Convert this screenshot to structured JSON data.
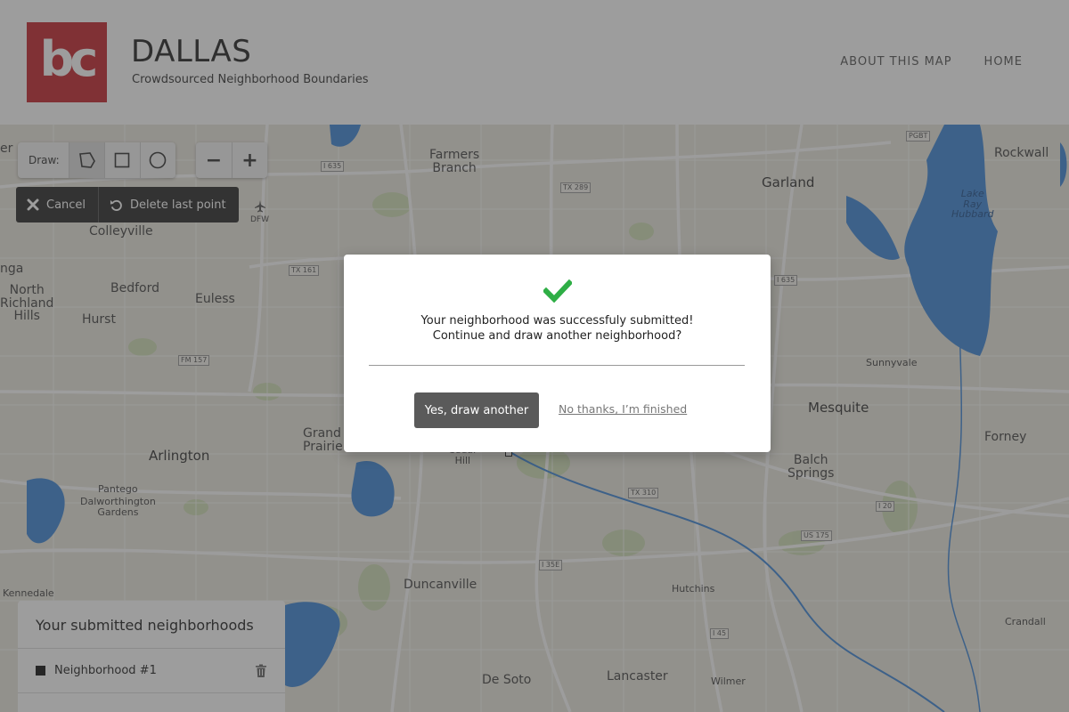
{
  "header": {
    "logo_text": "bc",
    "title": "DALLAS",
    "subtitle": "Crowdsourced Neighborhood Boundaries",
    "nav": [
      "ABOUT THIS MAP",
      "HOME"
    ]
  },
  "map_controls": {
    "draw_label": "Draw:",
    "draw_tools": [
      "polygon-icon",
      "rectangle-icon",
      "circle-icon"
    ],
    "zoom_out": "−",
    "zoom_in": "+",
    "cancel_label": "Cancel",
    "delete_last_point_label": "Delete last point"
  },
  "map_labels": {
    "farmers_branch": "Farmers\nBranch",
    "garland": "Garland",
    "rockwall": "Rockwall",
    "lake_ray_hubbard": "Lake\nRay\nHubbard",
    "colleyville": "Colleyville",
    "bedford": "Bedford",
    "euless": "Euless",
    "north_richland_hills": "North\nRichland\nHills",
    "hurst": "Hurst",
    "nga": "nga",
    "er": "er",
    "dfw": "DFW",
    "sunnyvale": "Sunnyvale",
    "mesquite": "Mesquite",
    "forney": "Forney",
    "grand_prairie": "Grand\nPrairie",
    "arlington": "Arlington",
    "cedar_hill": "Cedar\nHill",
    "balch_springs": "Balch\nSprings",
    "pantego": "Pantego",
    "dalworthington_gardens": "Dalworthington\nGardens",
    "kennedale": "Kennedale",
    "duncanville": "Duncanville",
    "hutchins": "Hutchins",
    "crandall": "Crandall",
    "de_soto": "De Soto",
    "lancaster": "Lancaster",
    "wilmer": "Wilmer"
  },
  "highway_labels": {
    "i635_w": "I 635",
    "tx289": "TX 289",
    "pgbt": "PGBT",
    "tx161": "TX 161",
    "i635_e": "I 635",
    "fm157": "FM 157",
    "tx310": "TX 310",
    "i20": "I 20",
    "us175": "US 175",
    "i35e": "I 35E",
    "i45": "I 45"
  },
  "submitted_panel": {
    "title": "Your submitted neighborhoods",
    "items": [
      {
        "name": "Neighborhood #1",
        "color": "#111111"
      }
    ]
  },
  "modal": {
    "icon": "checkmark-icon",
    "message_line1": "Your neighborhood was successfuly submitted!",
    "message_line2": "Continue and draw another neighborhood?",
    "primary_label": "Yes, draw another",
    "secondary_label": "No thanks, I’m finished"
  },
  "colors": {
    "brand": "#c4262e",
    "success": "#2eae45",
    "water": "#3f86d6",
    "primary_button": "#5a5a5a"
  }
}
